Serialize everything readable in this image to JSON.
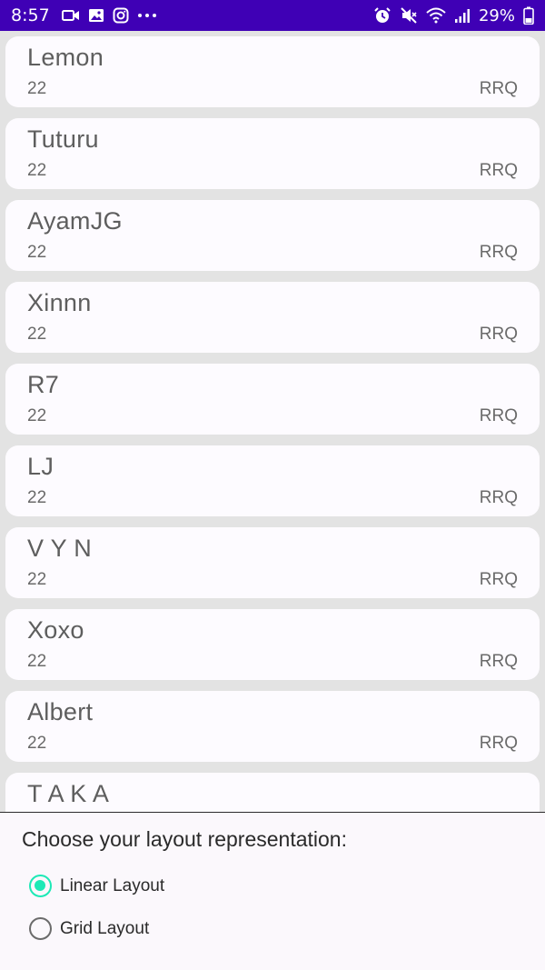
{
  "status_bar": {
    "time": "8:57",
    "notification_icons": [
      "video-icon",
      "image-icon",
      "instagram-icon",
      "more-icon"
    ],
    "system_icons": [
      "alarm-icon",
      "mute-icon",
      "wifi-icon",
      "signal-icon"
    ],
    "battery": "29%",
    "background": "#3f00b5"
  },
  "players": [
    {
      "name": "Lemon",
      "age": "22",
      "team": "RRQ"
    },
    {
      "name": "Tuturu",
      "age": "22",
      "team": "RRQ"
    },
    {
      "name": "AyamJG",
      "age": "22",
      "team": "RRQ"
    },
    {
      "name": "Xinnn",
      "age": "22",
      "team": "RRQ"
    },
    {
      "name": "R7",
      "age": "22",
      "team": "RRQ"
    },
    {
      "name": "LJ",
      "age": "22",
      "team": "RRQ"
    },
    {
      "name": "V Y N",
      "age": "22",
      "team": "RRQ"
    },
    {
      "name": "Xoxo",
      "age": "22",
      "team": "RRQ"
    },
    {
      "name": "Albert",
      "age": "22",
      "team": "RRQ"
    },
    {
      "name": "T A K A",
      "age": "",
      "team": ""
    }
  ],
  "layout_chooser": {
    "title": "Choose your layout representation:",
    "options": [
      {
        "label": "Linear Layout",
        "selected": true
      },
      {
        "label": "Grid Layout",
        "selected": false
      }
    ],
    "accent_color": "#1de9b6"
  }
}
